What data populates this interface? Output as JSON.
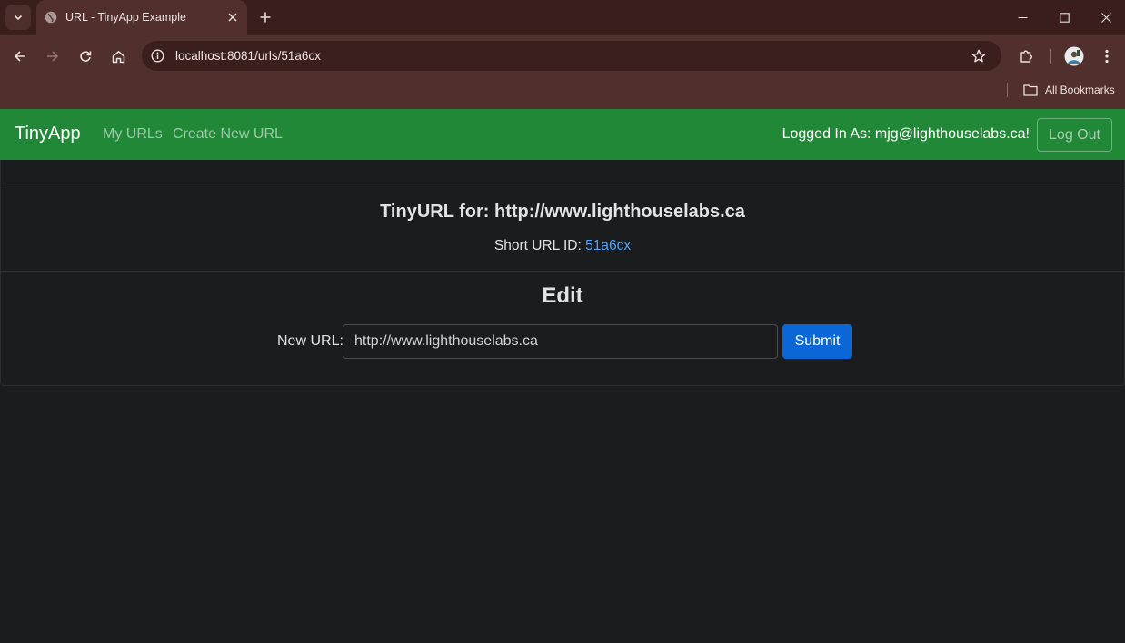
{
  "browser": {
    "tab_title": "URL - TinyApp Example",
    "address": "localhost:8081/urls/51a6cx",
    "bookmarks_label": "All Bookmarks"
  },
  "navbar": {
    "brand": "TinyApp",
    "links": [
      "My URLs",
      "Create New URL"
    ],
    "logged_in_text": "Logged In As: mjg@lighthouselabs.ca!",
    "logout_label": "Log Out",
    "bg_color": "#218838"
  },
  "detail": {
    "title": "TinyURL for: http://www.lighthouselabs.ca",
    "short_id_label": "Short URL ID:",
    "short_id": "51a6cx"
  },
  "edit": {
    "heading": "Edit",
    "label": "New URL:",
    "input_value": "http://www.lighthouselabs.ca",
    "submit_label": "Submit",
    "accent_color": "#0b66d6"
  },
  "icons": [
    "tab-search-icon",
    "globe-icon",
    "close-icon",
    "plus-icon",
    "minimize-icon",
    "maximize-icon",
    "back-icon",
    "forward-icon",
    "reload-icon",
    "home-icon",
    "info-icon",
    "star-icon",
    "extensions-icon",
    "avatar",
    "more-icon",
    "folder-icon"
  ]
}
